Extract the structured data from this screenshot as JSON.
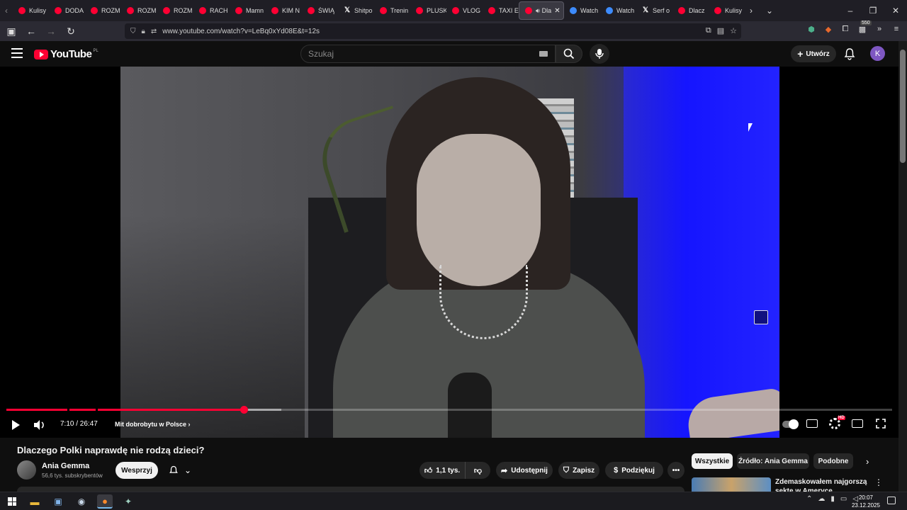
{
  "browser": {
    "tabs": [
      {
        "label": "Kulisy",
        "icon": "youtube-icon"
      },
      {
        "label": "DODA",
        "icon": "youtube-icon"
      },
      {
        "label": "ROZM",
        "icon": "youtube-icon"
      },
      {
        "label": "ROZM",
        "icon": "youtube-icon"
      },
      {
        "label": "ROZM",
        "icon": "youtube-icon"
      },
      {
        "label": "RACH",
        "icon": "youtube-icon"
      },
      {
        "label": "Mamn",
        "icon": "youtube-icon"
      },
      {
        "label": "KIM N",
        "icon": "youtube-icon"
      },
      {
        "label": "ŚWIĄ",
        "icon": "youtube-icon"
      },
      {
        "label": "Shitpo",
        "icon": "x-icon"
      },
      {
        "label": "Trenin",
        "icon": "youtube-icon"
      },
      {
        "label": "PLUSK",
        "icon": "youtube-icon"
      },
      {
        "label": "VLOG",
        "icon": "youtube-icon"
      },
      {
        "label": "TAXI E",
        "icon": "youtube-icon"
      },
      {
        "label": "Dla",
        "icon": "youtube-icon",
        "active": true
      },
      {
        "label": "Watch",
        "icon": "watch-icon"
      },
      {
        "label": "Watch",
        "icon": "watch-icon"
      },
      {
        "label": "Serf o",
        "icon": "x-icon"
      },
      {
        "label": "Dlacz",
        "icon": "youtube-icon"
      },
      {
        "label": "Kulisy",
        "icon": "youtube-icon"
      }
    ],
    "url": "www.youtube.com/watch?v=LeBq0xYd08E&t=12s",
    "extension_badge": "550"
  },
  "youtube": {
    "logo_text": "YouTube",
    "logo_country": "PL",
    "search_placeholder": "Szukaj",
    "create_label": "Utwórz",
    "avatar_letter": "K"
  },
  "player": {
    "current_time": "7:10",
    "duration": "26:47",
    "time_display": "7:10 / 26:47",
    "chapter": "Mit dobrobytu w Polsce",
    "played_fraction": 0.268,
    "loaded_fraction": 0.31,
    "hd_badge": "HD",
    "accent_color": "#ff0033"
  },
  "video": {
    "title": "Dlaczego Polki naprawdę nie rodzą dzieci?",
    "channel_name": "Ania Gemma",
    "subscribers": "56,6 tys. subskrybentów",
    "support_label": "Wesprzyj",
    "like_count": "1,1 tys.",
    "share_label": "Udostępnij",
    "save_label": "Zapisz",
    "thanks_label": "Podziękuj"
  },
  "chips": [
    {
      "label": "Wszystkie",
      "active": true
    },
    {
      "label": "Źródło: Ania Gemma",
      "active": false
    },
    {
      "label": "Podobne",
      "active": false
    }
  ],
  "recommendation": {
    "title": "Zdemaskowałem najgorszą sektę w Ameryce"
  },
  "taskbar": {
    "time": "20:07",
    "date": "23.12.2025"
  }
}
